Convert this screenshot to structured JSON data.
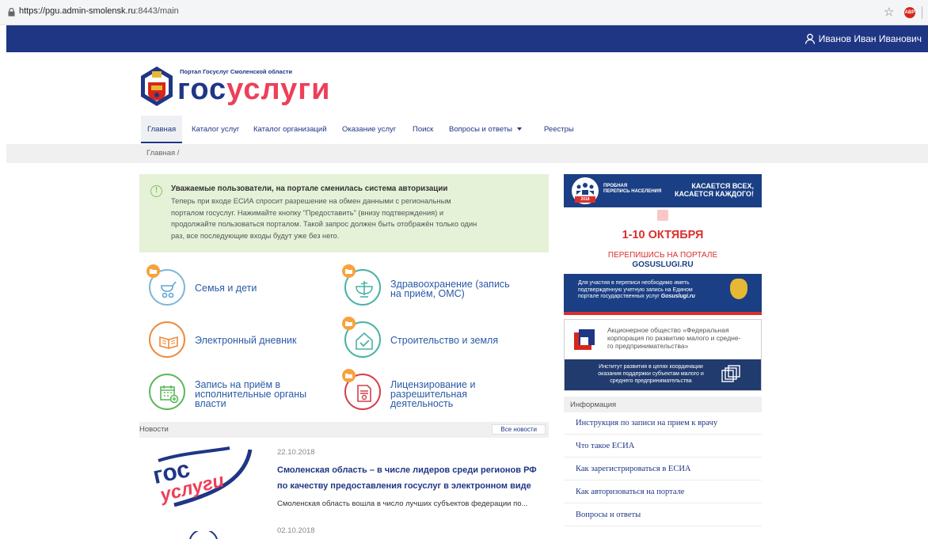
{
  "browser": {
    "url_host": "https://pgu.admin-smolensk.ru",
    "url_rest": ":8443/main",
    "ext_label": "ABP"
  },
  "header": {
    "user_name": "Иванов Иван Иванович"
  },
  "logo": {
    "subtitle": "Портал Госуслуг Смоленской области",
    "word_part1": "гос",
    "word_part2": "услуги"
  },
  "nav": {
    "items": [
      {
        "label": "Главная",
        "active": true
      },
      {
        "label": "Каталог услуг"
      },
      {
        "label": "Каталог организаций"
      },
      {
        "label": "Оказание услуг"
      },
      {
        "label": "Поиск"
      },
      {
        "label": "Вопросы и ответы"
      },
      {
        "label": "Реестры"
      }
    ]
  },
  "breadcrumb": {
    "text": "Главная /"
  },
  "notice": {
    "title": "Уважаемые пользователи, на портале сменилась система авторизации",
    "text": "Теперь при входе ЕСИА спросит разрешение на обмен данными с региональным порталом госуслуг. Нажимайте кнопку \"Предоставить\" (внизу подтверждения) и продолжайте пользоваться порталом. Такой запрос должен быть отображён только один раз, все последующие входы будут уже без него."
  },
  "categories": [
    {
      "label_l1": "Семья и дети",
      "label_l2": "",
      "label_l3": ""
    },
    {
      "label_l1": "Здравоохранение (запись",
      "label_l2": "на приём, ОМС)",
      "label_l3": ""
    },
    {
      "label_l1": "Электронный дневник",
      "label_l2": "",
      "label_l3": ""
    },
    {
      "label_l1": "Строительство и земля",
      "label_l2": "",
      "label_l3": ""
    },
    {
      "label_l1": "Запись на приём в",
      "label_l2": "исполнительные органы",
      "label_l3": "власти"
    },
    {
      "label_l1": "Лицензирование и",
      "label_l2": "разрешительная",
      "label_l3": "деятельность"
    }
  ],
  "news": {
    "heading": "Новости",
    "all_button": "Все новости",
    "items": [
      {
        "date": "22.10.2018",
        "title_l1": "Смоленская область – в числе лидеров среди регионов РФ",
        "title_l2": "по качеству предоставления госуслуг в электронном виде",
        "lead": "Смоленская область вошла в число лучших субъектов федерации по...",
        "image_word1": "гос",
        "image_word2": "услуги"
      },
      {
        "date": "02.10.2018"
      }
    ]
  },
  "banner_census": {
    "small_l1": "ПРОБНАЯ",
    "small_l2": "ПЕРЕПИСЬ НАСЕЛЕНИЯ",
    "slogan_l1": "КАСАЕТСЯ ВСЕХ,",
    "slogan_l2": "КАСАЕТСЯ КАЖДОГО!",
    "year": "2018",
    "dates": "1-10 ОКТЯБРЯ",
    "prompt": "ПЕРЕПИШИСЬ НА ПОРТАЛЕ",
    "portal": "GOSUSLUGI.RU",
    "note_l1": "Для участия в переписи необходимо иметь",
    "note_l2": "подтвержденную учетную запись на Едином",
    "note_l3_a": "портале государственных услуг ",
    "note_l3_b": "Gosuslugi.ru"
  },
  "banner_msp": {
    "text_l1": "Акционерное общество «Федеральная",
    "text_l2": "корпорация по развитию малого и средне-",
    "text_l3": "го предпринимательства»",
    "sub_l1": "Институт развития в целях координации",
    "sub_l2": "оказания поддержки субъектам малого и",
    "sub_l3": "среднего предпринимательства"
  },
  "info": {
    "heading": "Информация",
    "links": [
      "Инструкция по записи на прием к врачу",
      "Что такое ЕСИА",
      "Как зарегистрироваться в ЕСИА",
      "Как авторизоваться на портале",
      "Вопросы и ответы"
    ]
  },
  "colors": {
    "brand_blue": "#1f3685",
    "brand_red": "#ee3f58",
    "notice_bg": "#e5f2d8",
    "accent_orange": "#f7a23c"
  }
}
